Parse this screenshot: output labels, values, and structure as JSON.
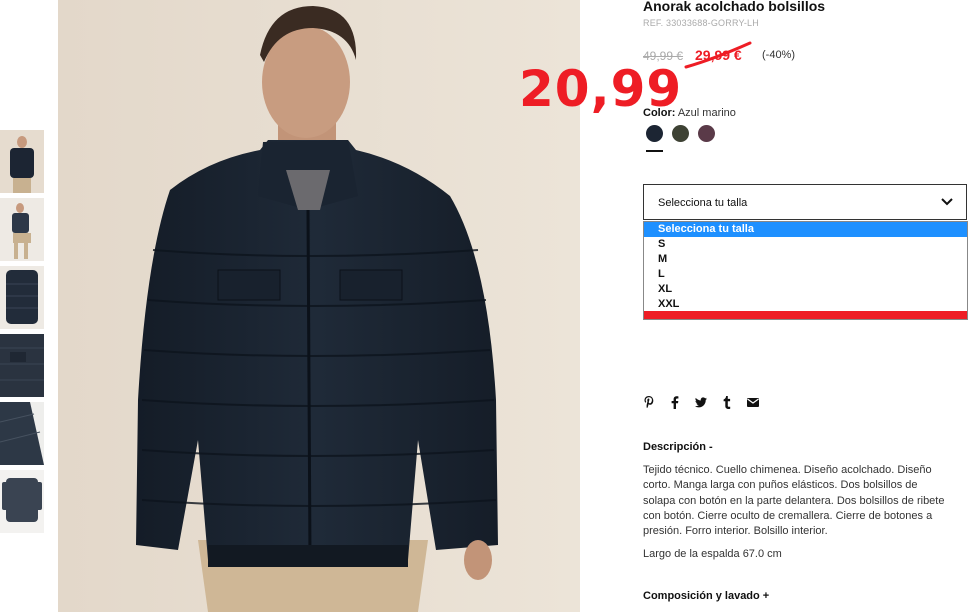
{
  "product": {
    "title": "Anorak acolchado bolsillos",
    "ref": "REF. 33033688-GORRY-LH",
    "old_price": "49,99 €",
    "current_price": "29,99 €",
    "discount": "(-40%)",
    "annotation_price": "20,99",
    "color_label": "Color:",
    "color_value": "Azul marino",
    "swatches": [
      "#1c2533",
      "#3e4234",
      "#5a3a48"
    ]
  },
  "size_select": {
    "label": "Selecciona tu talla",
    "options": [
      "Selecciona tu talla",
      "S",
      "M",
      "L",
      "XL",
      "XXL"
    ]
  },
  "share_icons": [
    "pinterest-icon",
    "facebook-icon",
    "twitter-icon",
    "tumblr-icon",
    "email-icon"
  ],
  "description": {
    "title": "Descripción -",
    "text": "Tejido técnico. Cuello chimenea. Diseño acolchado. Diseño corto. Manga larga con puños elásticos. Dos bolsillos de solapa con botón en la parte delantera. Dos bolsillos de ribete con botón. Cierre oculto de cremallera. Cierre de botones a presión. Forro interior. Bolsillo interior.",
    "length": "Largo de la espalda 67.0 cm"
  },
  "composition": {
    "title": "Composición y lavado +"
  },
  "colors": {
    "sale_red": "#ee1d25",
    "accent_blue": "#1e90ff"
  }
}
